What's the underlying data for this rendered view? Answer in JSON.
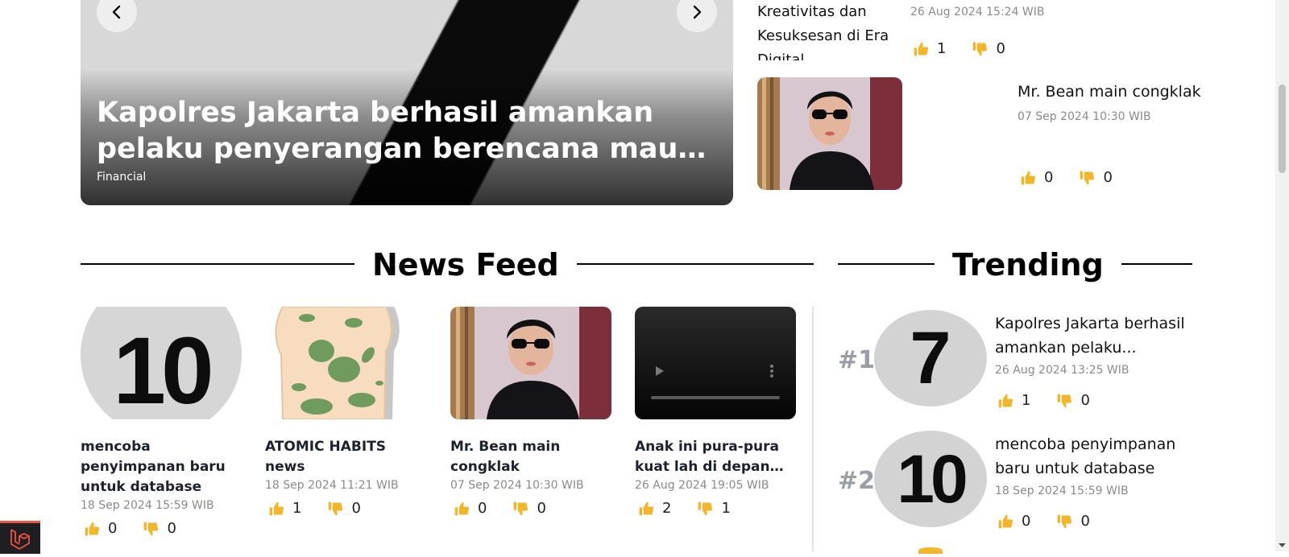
{
  "carousel": {
    "title": "Kapolres Jakarta berhasil amankan pelaku penyerangan berencana mau memberikan...",
    "category": "Financial"
  },
  "side_list": [
    {
      "title": "Kreativitas dan Kesuksesan di Era Digital",
      "date": "26 Aug 2024 15:24 WIB",
      "likes": "1",
      "dislikes": "0"
    },
    {
      "title": "Mr. Bean main congklak",
      "date": "07 Sep 2024 10:30 WIB",
      "likes": "0",
      "dislikes": "0"
    }
  ],
  "news_feed": {
    "heading": "News Feed",
    "items": [
      {
        "title": "mencoba penyimpanan baru untuk database",
        "date": "18 Sep 2024 15:59 WIB",
        "likes": "0",
        "dislikes": "0",
        "image_text": "10"
      },
      {
        "title": "ATOMIC HABITS news",
        "date": "18 Sep 2024 11:21 WIB",
        "likes": "1",
        "dislikes": "0"
      },
      {
        "title": "Mr. Bean main congklak",
        "date": "07 Sep 2024 10:30 WIB",
        "likes": "0",
        "dislikes": "0"
      },
      {
        "title": "Anak ini pura-pura kuat lah di depan temanny...",
        "date": "26 Aug 2024 19:05 WIB",
        "likes": "2",
        "dislikes": "1"
      }
    ]
  },
  "trending": {
    "heading": "Trending",
    "items": [
      {
        "rank": "#1",
        "title": "Kapolres Jakarta berhasil amankan pelaku...",
        "date": "26 Aug 2024 13:25 WIB",
        "likes": "1",
        "dislikes": "0",
        "image_text": "7"
      },
      {
        "rank": "#2",
        "title": "mencoba penyimpanan baru untuk database",
        "date": "18 Sep 2024 15:59 WIB",
        "likes": "0",
        "dislikes": "0",
        "image_text": "10"
      }
    ]
  },
  "icons": {
    "like": "thumbs-up-icon",
    "dislike": "thumbs-down-icon",
    "accent": "#f3b62a",
    "laravel": "#f05340"
  }
}
